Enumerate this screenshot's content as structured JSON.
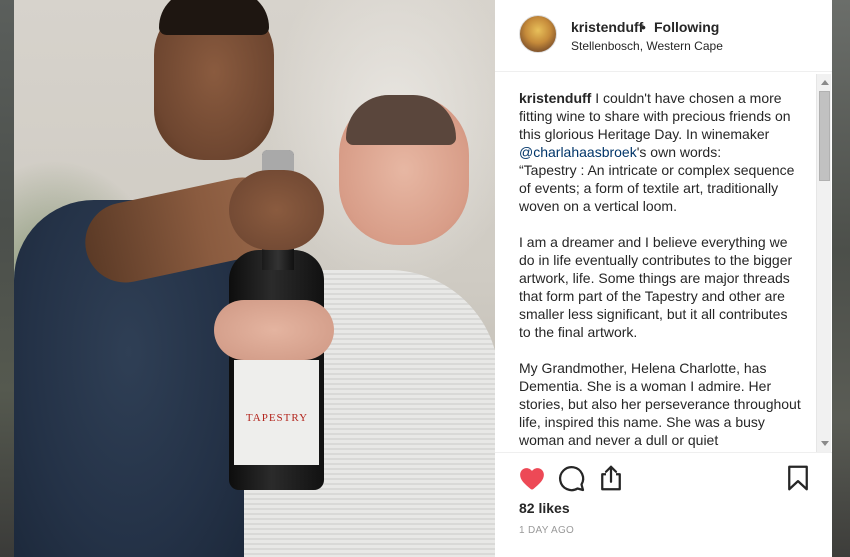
{
  "post": {
    "username": "kristenduff",
    "separator": "•",
    "follow_status": "Following",
    "location": "Stellenbosch, Western Cape",
    "caption": {
      "username": "kristenduff",
      "text_part1": " I couldn't have chosen a more fitting wine to share with precious friends on this glorious Heritage Day. In winemaker ",
      "mention": "@charlahaasbroek",
      "text_part2": "'s own words:\n“Tapestry : An intricate or complex sequence of events; a form of textile art, traditionally woven on a vertical loom.\n\nI am a dreamer and I believe everything we do in life eventually contributes to the bigger artwork, life. Some things are major threads that form part of the Tapestry and other are smaller less significant, but it all contributes to the final artwork.\n\nMy Grandmother, Helena Charlotte, has Dementia. She is a woman I admire. Her stories, but also her perseverance throughout life, inspired this name. She was a busy woman and never a dull or quiet"
    },
    "likes": "82 likes",
    "timestamp": "1 DAY AGO",
    "bottle_label": "TAPESTRY"
  },
  "icons": {
    "heart": "heart-icon",
    "comment": "comment-icon",
    "share": "share-icon",
    "save": "bookmark-icon"
  },
  "colors": {
    "liked_heart": "#ed4956",
    "mention": "#003569",
    "text": "#262626",
    "muted": "#999999"
  }
}
